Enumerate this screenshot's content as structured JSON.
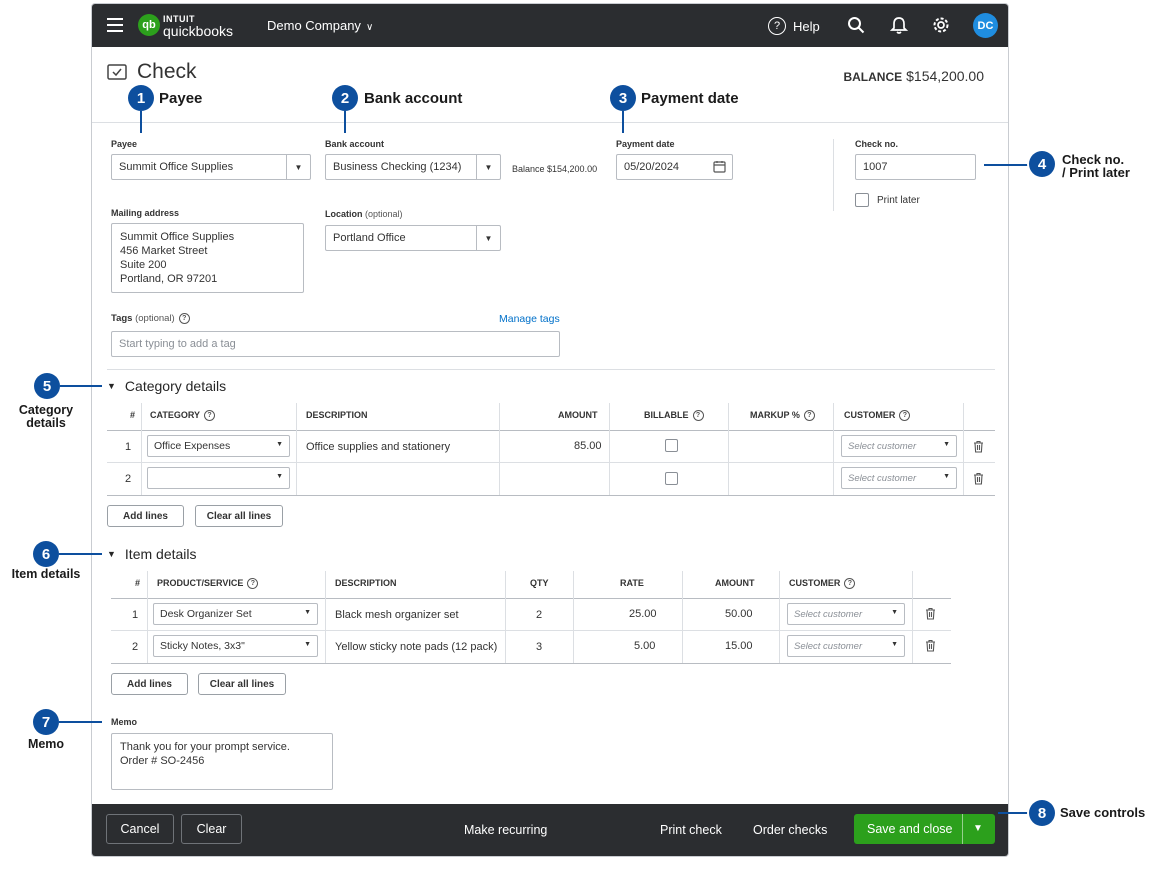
{
  "app": {
    "brand_top": "INTUIT",
    "brand_bottom": "quickbooks",
    "company": "Demo Company",
    "help_label": "Help",
    "avatar_initials": "DC"
  },
  "page": {
    "title": "Check",
    "balance_label": "BALANCE",
    "balance_value": "$154,200.00"
  },
  "form": {
    "payee_label": "Payee",
    "payee_value": "Summit Office Supplies",
    "bank_label": "Bank account",
    "bank_value": "Business Checking (1234)",
    "bank_balance": "Balance $154,200.00",
    "date_label": "Payment date",
    "date_value": "05/20/2024",
    "checkno_label": "Check no.",
    "checkno_value": "1007",
    "print_later": "Print later",
    "mailing_label": "Mailing address",
    "mailing_lines": [
      "Summit Office Supplies",
      "456 Market Street",
      "Suite 200",
      "Portland, OR 97201"
    ],
    "location_label": "Location",
    "location_optional": "(optional)",
    "location_value": "Portland Office",
    "tags_label": "Tags",
    "tags_optional": "(optional)",
    "tags_placeholder": "Start typing to add a tag",
    "manage_tags": "Manage tags"
  },
  "category_details": {
    "title": "Category details",
    "headers": [
      "#",
      "CATEGORY",
      "DESCRIPTION",
      "AMOUNT",
      "BILLABLE",
      "MARKUP %",
      "CUSTOMER"
    ],
    "rows": [
      {
        "num": "1",
        "category": "Office Expenses",
        "description": "Office supplies and stationery",
        "amount": "85.00",
        "customer": "Select customer"
      },
      {
        "num": "2",
        "category": "",
        "description": "",
        "amount": "",
        "customer": "Select customer"
      }
    ],
    "add_lines": "Add lines",
    "clear_lines": "Clear all lines"
  },
  "item_details": {
    "title": "Item details",
    "headers": [
      "#",
      "PRODUCT/SERVICE",
      "DESCRIPTION",
      "QTY",
      "RATE",
      "AMOUNT",
      "CUSTOMER"
    ],
    "rows": [
      {
        "num": "1",
        "product": "Desk Organizer Set",
        "description": "Black mesh organizer set",
        "qty": "2",
        "rate": "25.00",
        "amount": "50.00",
        "customer": "Select customer"
      },
      {
        "num": "2",
        "product": "Sticky Notes, 3x3\"",
        "description": "Yellow sticky note pads (12 pack)",
        "qty": "3",
        "rate": "5.00",
        "amount": "15.00",
        "customer": "Select customer"
      }
    ],
    "add_lines": "Add lines",
    "clear_lines": "Clear all lines"
  },
  "memo": {
    "label": "Memo",
    "lines": [
      "Thank you for your prompt service.",
      "Order # SO-2456"
    ]
  },
  "footer": {
    "cancel": "Cancel",
    "clear": "Clear",
    "make_recurring": "Make recurring",
    "print_check": "Print check",
    "order_checks": "Order checks",
    "save_close": "Save and close"
  },
  "annotations": {
    "a1": {
      "num": "1",
      "label": "Payee"
    },
    "a2": {
      "num": "2",
      "label": "Bank account"
    },
    "a3": {
      "num": "3",
      "label": "Payment date"
    },
    "a4": {
      "num": "4",
      "line1": "Check no.",
      "line2": "/ Print later"
    },
    "a5": {
      "num": "5",
      "line1": "Category",
      "line2": "details"
    },
    "a6": {
      "num": "6",
      "label": "Item details"
    },
    "a7": {
      "num": "7",
      "label": "Memo"
    },
    "a8": {
      "num": "8",
      "label": "Save controls"
    }
  },
  "colors": {
    "topbar": "#2b2d30",
    "brand_green": "#2ca01c",
    "annotation_blue": "#0d4f9e",
    "link_blue": "#0070c9",
    "avatar_blue": "#1f8de0"
  },
  "icons": [
    "menu-icon",
    "quickbooks-logo",
    "chevron-down-icon",
    "help-icon",
    "search-icon",
    "bell-icon",
    "gear-icon",
    "check-icon",
    "calendar-icon",
    "trash-icon",
    "caret-down-icon"
  ]
}
